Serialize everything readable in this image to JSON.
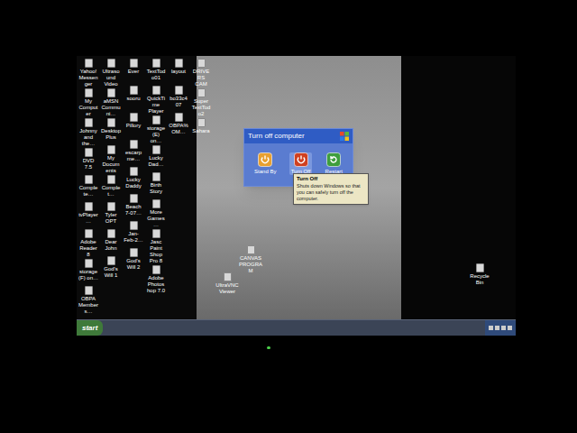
{
  "desktop": {
    "columns": [
      [
        "Yahoo! Messenger",
        "My Computer",
        "Johnny and the…",
        "DVD 7.5",
        "Complete…",
        "tvPlayer…",
        "Adobe Reader 8",
        "storage (F) on…",
        "OBPA Members…"
      ],
      [
        "Ultrasound Video",
        "aMSN Communi…",
        "Desktop Plus",
        "My Documents",
        "Complet…",
        "Tyler OPT",
        "Dear John",
        "God's Will 1"
      ],
      [
        "Ever",
        "sooru",
        "Pillory",
        "escarpme…",
        "Lucky Daddy",
        "Beach 7-07…",
        "Jan-Feb-2…",
        "God's Will 2"
      ],
      [
        "TextTodo01",
        "QuickTime Player",
        "storage (E) on…",
        "Lucky Dad…",
        "Birth Story",
        "More Games…",
        "Jasc Paint Shop Pro 8",
        "Adobe Photoshop 7.0"
      ],
      [
        "layout",
        "bo33c407",
        "OBPA% OM…"
      ],
      [
        "DRIVERS CAM",
        "Super TextTodo2",
        "Sahara"
      ]
    ],
    "free_icons": [
      "CANVAS PROGRAM",
      "UltraVNC Viewer",
      "Recycle Bin"
    ]
  },
  "dialog": {
    "title": "Turn off computer",
    "options": [
      {
        "label": "Stand By",
        "selected": false,
        "color": "#e8a030"
      },
      {
        "label": "Turn Off",
        "selected": true,
        "color": "#d04020"
      },
      {
        "label": "Restart",
        "selected": false,
        "color": "#3e9e3e"
      }
    ]
  },
  "tooltip": {
    "title": "Turn Off",
    "text": "Shuts down Windows so that you can safely turn off the computer."
  },
  "taskbar": {
    "start": "start"
  }
}
